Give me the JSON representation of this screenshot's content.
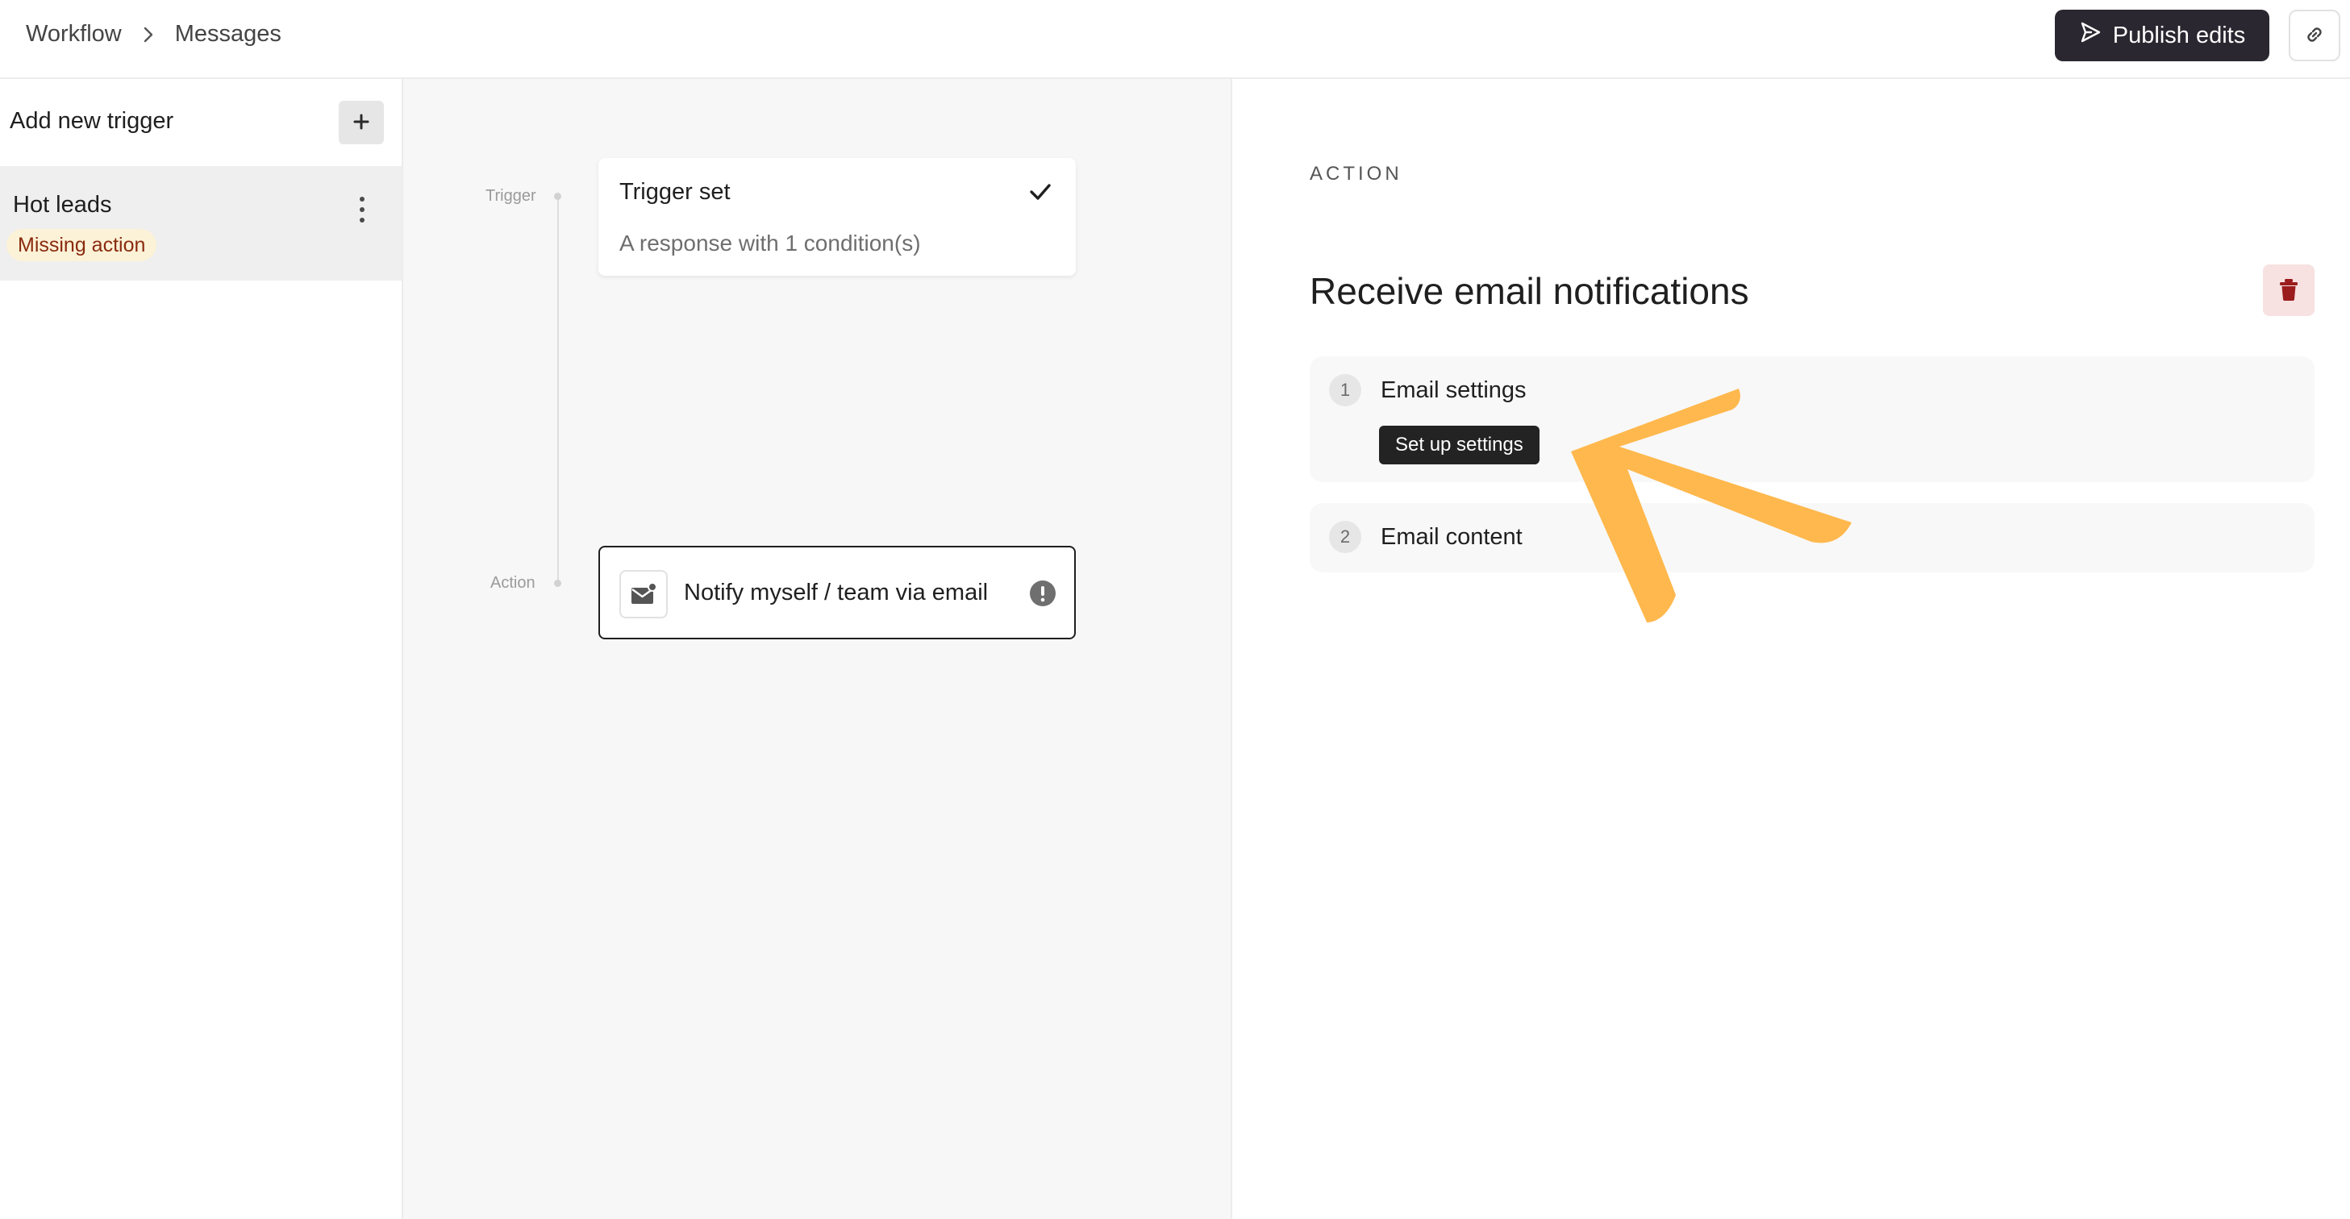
{
  "header": {
    "breadcrumb": {
      "root": "Workflow",
      "current": "Messages"
    },
    "publish_label": "Publish edits",
    "publish_icon": "send-icon",
    "link_icon": "link-icon"
  },
  "sidebar": {
    "add_trigger_label": "Add new trigger",
    "add_icon": "plus-icon",
    "items": [
      {
        "name": "Hot leads",
        "badge": "Missing action",
        "menu_icon": "kebab-menu-icon"
      }
    ]
  },
  "canvas": {
    "trigger_node_label": "Trigger",
    "action_node_label": "Action",
    "trigger_card": {
      "title": "Trigger set",
      "subtitle": "A response with 1 condition(s)",
      "status_icon": "checkmark-icon"
    },
    "action_card": {
      "label": "Notify myself / team via email",
      "icon": "email-notification-icon",
      "status_icon": "warning-icon"
    }
  },
  "panel": {
    "section_label": "ACTION",
    "title": "Receive email notifications",
    "delete_icon": "trash-icon",
    "steps": [
      {
        "number": "1",
        "title": "Email settings",
        "button": "Set up settings"
      },
      {
        "number": "2",
        "title": "Email content"
      }
    ]
  },
  "colors": {
    "primary_button": "#2b2730",
    "badge_bg": "#fcf2d7",
    "badge_text": "#8a2b0f",
    "delete_bg": "#f7e1e1",
    "delete_icon": "#9b1c1c",
    "highlight_arrow": "#ffb84d"
  }
}
